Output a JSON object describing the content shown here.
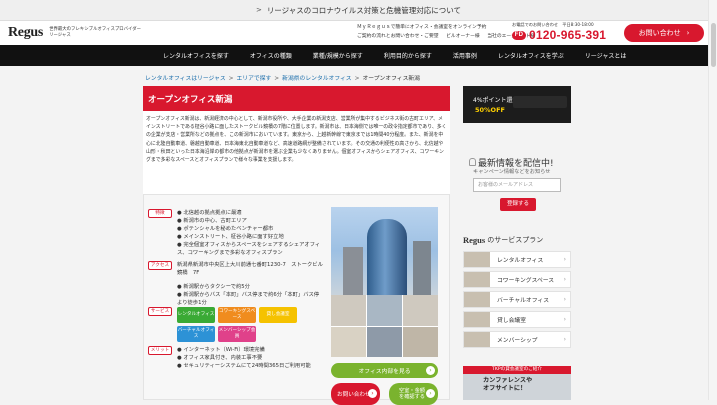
{
  "banner": {
    "text": "リージャスのコロナウイルス対策と危機管理対応について",
    "chevron": ">"
  },
  "header": {
    "logo": "Regus",
    "tagline": [
      "世界最大のフレキシブルオフィスプロバイダー",
      "リージャス"
    ],
    "links_row1": [
      "ＭｙＲｅｇｕｓで簡単にオフィス・会議室をオンライン予約"
    ],
    "links_row2": [
      "ご契約の流れとお問い合わせ・ご要望",
      "ビルオーナー様",
      "当社のエージェント様"
    ],
    "phone_note": "お電話でのお問い合わせ　平日8:30-18:00",
    "free_dial": "FD",
    "phone": "0120-965-391",
    "cta": "お問い合わせ",
    "cta_arrow": "›"
  },
  "nav": {
    "items": [
      "レンタルオフィスを探す",
      "オフィスの種類",
      "業種/規模から探す",
      "利用目的から探す",
      "活用事例",
      "レンタルオフィスを学ぶ",
      "リージャスとは"
    ]
  },
  "breadcrumb": {
    "items": [
      "レンタルオフィスはリージャス",
      "エリアで探す",
      "新潟県のレンタルオフィス"
    ],
    "current": "オープンオフィス新潟",
    "sep": ">"
  },
  "main": {
    "title": "オープンオフィス新潟",
    "intro": "オープンオフィス新潟は、新潟経済の中心として、新潟市役所や、大手企業の新潟支店、営業所が集中するビジネス街の古町エリア、メインストリートである柾谷小路に面したストークビル鏡橋の7階に位置します。新潟市は、日本海側では唯一の政令指定都市であり、多くの企業が支店・営業所などの拠点を、この新潟市においています。東京から、上越新幹線で東京までは1時間40分程度。また、新潟を中心に北陸自動車道、磐越自動車道、日本海東北自動車道など、高速道路網が整備されています。その交通の利便性の高さから、北信越や山形・秋田といった日本海沿岸の都市の他拠点が新潟市を選ぶ企業も少なくありません。個室オフィスからシェアオフィス、コワーキングまで多彩なスペースとオフィスプランで様々な事業を支援します。",
    "labels": {
      "features": "特徴",
      "access": "アクセス",
      "service": "サービス",
      "merit": "メリット"
    },
    "features": [
      "北信越の拠点拠点に最適",
      "新潟市の中心、古町エリア",
      "ポテンシャルを秘めたベンチャー都市",
      "メインストリート、柾谷小路に面す好立地",
      "完全個室オフィスからスペースをシェアするシェアオフィス、コワーキングまで多彩なオフィスプラン"
    ],
    "address": "新潟県新潟市中央区上大川前通七番町1230-7　ストークビル鏡橋　7F",
    "access": [
      "新潟駅からタクシーで約5分",
      "新潟駅からバス「本町」バス停まで約6分「本町」バス停より徒歩1分"
    ],
    "services": [
      "レンタルオフィス",
      "コワーキングスペース",
      "貸し会議室",
      "バーチャルオフィス",
      "メンバーシップ会員"
    ],
    "merits": [
      "インターネット（Wi-Fi）環境完備",
      "オフィス家具付き、内装工事不要",
      "セキュリティーシステムにて24時間365日ご利用可能"
    ],
    "view_inside": "オフィス内部を見る",
    "contact": "お問い合わせ",
    "price": "空室・金額を確認する",
    "arrow": "›"
  },
  "side": {
    "ad1": {
      "line": "4%ポイント還元",
      "pct": "50%OFF"
    },
    "news_title": "最新情報を配信中!",
    "news_sub": "キャンペーン情報などをお知らせ",
    "email_placeholder": "お客様のメールアドレス",
    "register": "登録する",
    "plans_brand": "Regus",
    "plans_suffix": "のサービスプラン",
    "plans": [
      "レンタルオフィス",
      "コワーキングスペース",
      "バーチャルオフィス",
      "貸し会議室",
      "メンバーシップ"
    ],
    "chev": "›",
    "ad2_hdr": "TKPの貸会議室のご紹介",
    "ad2_line1": "カンファレンスや",
    "ad2_line2": "オフサイトに！"
  }
}
